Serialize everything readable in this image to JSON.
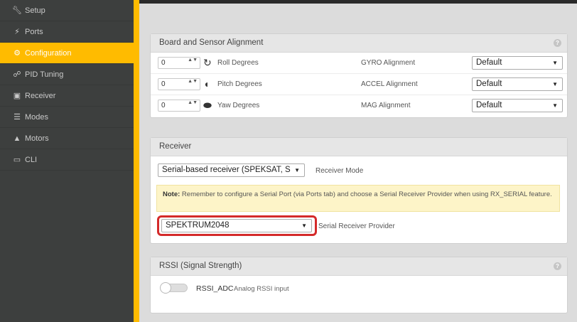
{
  "sidebar": {
    "items": [
      {
        "label": "Setup",
        "icon": "wrench-icon",
        "active": false
      },
      {
        "label": "Ports",
        "icon": "plug-icon",
        "active": false
      },
      {
        "label": "Configuration",
        "icon": "gear-icon",
        "active": true
      },
      {
        "label": "PID Tuning",
        "icon": "sliders-icon",
        "active": false
      },
      {
        "label": "Receiver",
        "icon": "receiver-icon",
        "active": false
      },
      {
        "label": "Modes",
        "icon": "modes-icon",
        "active": false
      },
      {
        "label": "Motors",
        "icon": "motor-icon",
        "active": false
      },
      {
        "label": "CLI",
        "icon": "terminal-icon",
        "active": false
      }
    ],
    "accent_color": "#ffbb00"
  },
  "board_alignment": {
    "title": "Board and Sensor Alignment",
    "rows": [
      {
        "value": "0",
        "axis_label": "Roll Degrees",
        "align_label": "GYRO Alignment",
        "select": "Default"
      },
      {
        "value": "0",
        "axis_label": "Pitch Degrees",
        "align_label": "ACCEL Alignment",
        "select": "Default"
      },
      {
        "value": "0",
        "axis_label": "Yaw Degrees",
        "align_label": "MAG Alignment",
        "select": "Default"
      }
    ]
  },
  "receiver": {
    "title": "Receiver",
    "mode_select": "Serial-based receiver (SPEKSAT, S",
    "mode_label": "Receiver Mode",
    "note_bold": "Note:",
    "note_text": " Remember to configure a Serial Port (via Ports tab) and choose a Serial Receiver Provider when using RX_SERIAL feature.",
    "provider_select": "SPEKTRUM2048",
    "provider_label": "Serial Receiver Provider"
  },
  "rssi": {
    "title": "RSSI (Signal Strength)",
    "toggle_name": "RSSI_ADC",
    "toggle_desc": "Analog RSSI input",
    "enabled": false
  },
  "glyphs": {
    "spin": "▲▼",
    "arrow": "▼",
    "help": "?"
  }
}
